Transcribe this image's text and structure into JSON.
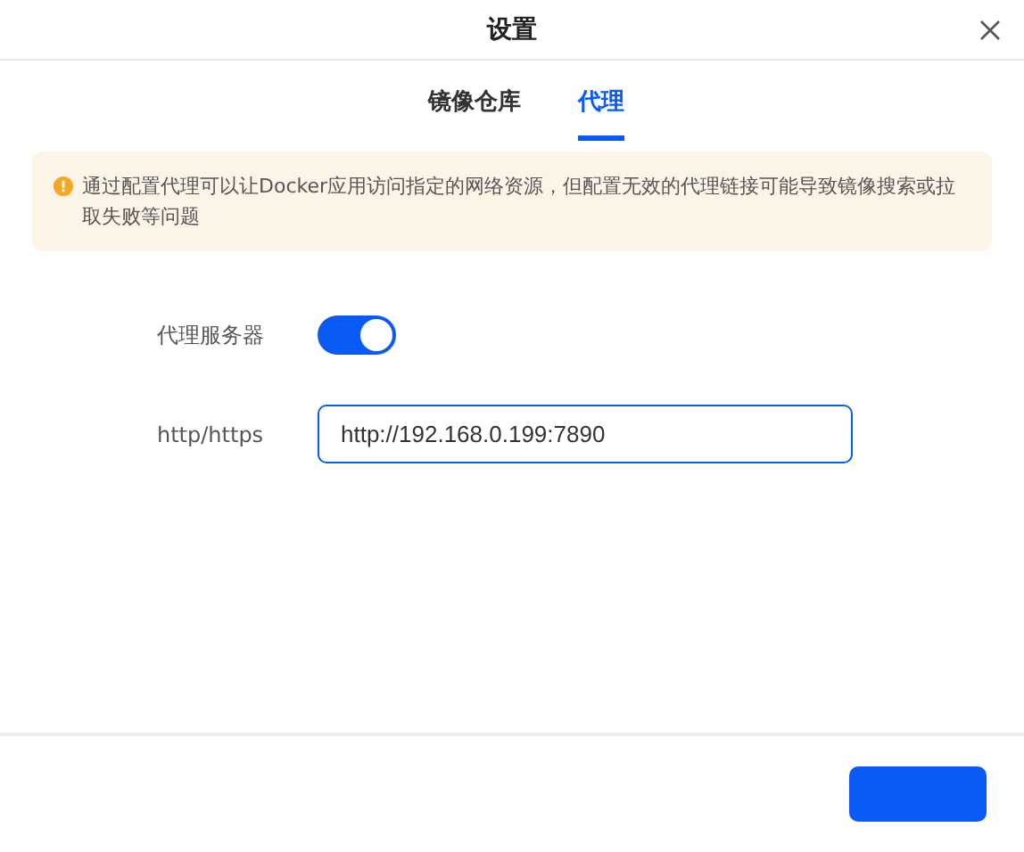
{
  "window": {
    "title": "设置"
  },
  "tabs": [
    {
      "label": "镜像仓库",
      "selected": false
    },
    {
      "label": "代理",
      "selected": true
    }
  ],
  "notice": {
    "text": "通过配置代理可以让Docker应用访问指定的网络资源，但配置无效的代理链接可能导致镜像搜索或拉取失败等问题"
  },
  "form": [
    {
      "kind": "toggle",
      "label": "代理服务器",
      "on": true
    },
    {
      "kind": "input",
      "label": "http/https",
      "value": "http://192.168.0.199:7890"
    }
  ],
  "footer": {
    "buttons": [
      {
        "kind": "primary"
      }
    ]
  }
}
